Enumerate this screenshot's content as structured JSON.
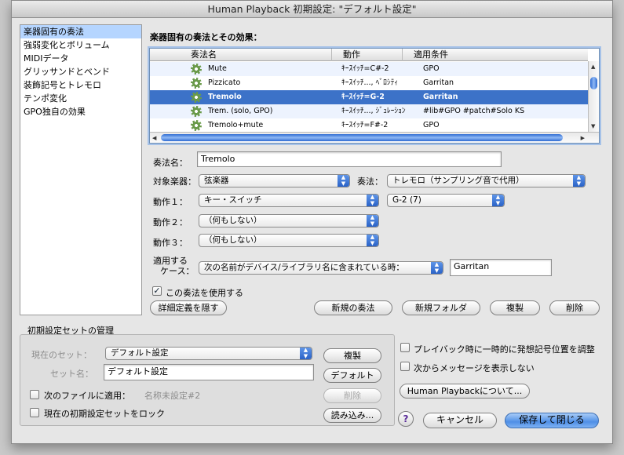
{
  "window": {
    "title": "Human Playback 初期設定: \"デフォルト設定\""
  },
  "sidebar": {
    "items": [
      {
        "label": "楽器固有の奏法",
        "selected": true
      },
      {
        "label": "強弱変化とボリューム"
      },
      {
        "label": "MIDIデータ"
      },
      {
        "label": "グリッサンドとベンド"
      },
      {
        "label": "装飾記号とトレモロ"
      },
      {
        "label": "テンポ変化"
      },
      {
        "label": "GPO独自の効果"
      }
    ]
  },
  "main": {
    "section_title": "楽器固有の奏法とその効果：",
    "table": {
      "columns": [
        "奏法名",
        "動作",
        "適用条件"
      ],
      "rows": [
        {
          "name": "Mute",
          "action": "ｷｰｽｲｯﾁ=C#-2",
          "condition": "GPO"
        },
        {
          "name": "Pizzicato",
          "action": "ｷｰｽｲｯﾁ..., ﾍﾞﾛｼﾃｨ",
          "condition": "Garritan"
        },
        {
          "name": "Tremolo",
          "action": "ｷｰｽｲｯﾁ=G-2",
          "condition": "Garritan",
          "selected": true
        },
        {
          "name": "Trem. (solo, GPO)",
          "action": "ｷｰｽｲｯﾁ..., ｼﾞｭﾚｰｼｮﾝ",
          "condition": "#lib#GPO #patch#Solo KS"
        },
        {
          "name": "Tremolo+mute",
          "action": "ｷｰｽｲｯﾁ=F#-2",
          "condition": "GPO"
        }
      ]
    },
    "form": {
      "technique_name_label": "奏法名：",
      "technique_name_value": "Tremolo",
      "target_label": "対象楽器：",
      "target_value": "弦楽器",
      "technique_label": "奏法：",
      "technique_value": "トレモロ（サンプリング音で代用）",
      "action1_label": "動作１：",
      "action1_value": "キー・スイッチ",
      "action1_note": "G-2 (7)",
      "action2_label": "動作２：",
      "action2_value": "（何もしない）",
      "action3_label": "動作３：",
      "action3_value": "（何もしない）",
      "apply_label_1": "適用する",
      "apply_label_2": "ケース：",
      "apply_value": "次の名前がデバイス/ライブラリ名に含まれている時：",
      "apply_text": "Garritan",
      "use_checkbox_label": "この奏法を使用する",
      "use_checked": true
    },
    "buttons": {
      "hide_details": "詳細定義を隠す",
      "new_technique": "新規の奏法",
      "new_folder": "新規フォルダ",
      "duplicate": "複製",
      "delete": "削除"
    }
  },
  "presets": {
    "group_title": "初期設定セットの管理",
    "current_set_label": "現在のセット：",
    "current_set_value": "デフォルト設定",
    "set_name_label": "セット名：",
    "set_name_value": "デフォルト設定",
    "apply_to_file_label": "次のファイルに適用：",
    "apply_to_file_value": "名称未設定#2",
    "lock_label": "現在の初期設定セットをロック",
    "buttons": {
      "duplicate": "複製",
      "default": "デフォルト",
      "delete": "削除",
      "load": "読み込み..."
    }
  },
  "options": {
    "adjust_label": "プレイバック時に一時的に発想記号位置を調整",
    "hide_message_label": "次からメッセージを表示しない",
    "about_button": "Human Playbackについて..."
  },
  "footer": {
    "help": "?",
    "cancel": "キャンセル",
    "save_close": "保存して閉じる"
  }
}
